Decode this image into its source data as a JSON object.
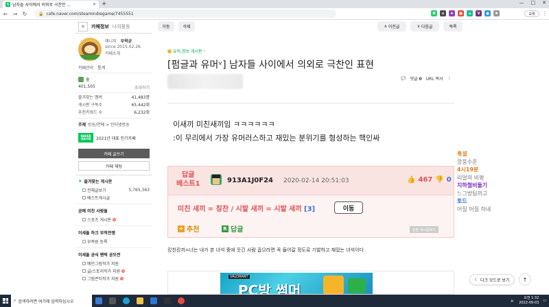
{
  "browser": {
    "tab_title": "남자들 사이에서 의외로 극찬인 ...",
    "url": "cafe.naver.com/steamindiegame/7455551",
    "profile_label": "오류"
  },
  "sidebar": {
    "tab_active": "카페정보",
    "tab_other": "나의활동",
    "manager_label": "매니저",
    "owner": "우왁굳",
    "since": "since 2015.02.26.",
    "intro_link": "카페소개",
    "link_manage": "카페관리",
    "link_stats": "통계",
    "grade": "숲",
    "members": "401,505",
    "invite": "초대하기",
    "stats": [
      {
        "label": "즐겨찾는 멤버",
        "value": "41,483명"
      },
      {
        "label": "게시판 구독수",
        "value": "65,442회"
      },
      {
        "label": "추천키워드 수",
        "value": "6,232회"
      }
    ],
    "topic_label": "주제",
    "topic_value": "방송/연예 > 인터넷방송",
    "badge_top": "NAVER",
    "badge_bottom": "대표카페",
    "badge_text": "2021년 대표 인기카페",
    "write_btn": "카페 글쓰기",
    "chat_btn": "카페 채팅",
    "fav_board_head": "즐겨찾는 게시판",
    "fav_items": [
      {
        "label": "전체글보기",
        "count": "5,765,363"
      },
      {
        "label": "베스트게시글",
        "count": ""
      }
    ],
    "cat1": "공예 미친 사람들",
    "cat1_items": [
      {
        "label": "스포츠 게시판",
        "new": "N"
      }
    ],
    "cat2": "이세돌 하크 부적전쟁",
    "cat2_items": [
      {
        "label": "부족원 등록",
        "new": ""
      }
    ],
    "cat3": "이세돌 공식 팬픽 공모전",
    "cat3_items": [
      {
        "label": "메인그림작가 지원",
        "new": ""
      },
      {
        "label": "글/스토리작가 지원",
        "new": "N"
      },
      {
        "label": "그림콘티작가 지원",
        "new": "N"
      }
    ]
  },
  "toolbar": {
    "move": "이동",
    "delete": "삭제",
    "prev": "이전글",
    "next": "다음글",
    "list": "목록"
  },
  "article": {
    "board": "유머,정보 게시판",
    "title": "[펌글과 유머ᵛ] 남자들 사이에서 의외로 극찬인 표현",
    "comment_label": "댓글",
    "comment_count": "0",
    "url_copy": "URL 복사",
    "body_line1": "이새끼 미친새끼임 ㅋㅋㅋㅋㅋㅋ",
    "body_line2": ":이 무리에서 가장 유머러스하고 재밌는 분위기를 형성하는 핵인싸",
    "caption": "킹친킹끼=너는 내가 본 녀석 중에 웃긴 사람 꼽으라면 꼭 들어갈 정도로 기발하고 재밌는 녀석이다"
  },
  "best_comment": {
    "label_top": "답글",
    "label_bottom": "베스트1",
    "nickname": "913A1J0F24",
    "date": "2020-02-14 20:51:03",
    "up": "467",
    "down": "0",
    "text_red": "미친 새끼 = 칭찬 / 시발 새끼 = 시발 새끼",
    "text_blue": "[3]",
    "move_btn": "이동",
    "recommend": "추천",
    "reply": "답글",
    "source_btn": "원본 게시글보기"
  },
  "ad": {
    "tag": "VALORANT",
    "text": "PC방 썸머"
  },
  "overlay": [
    {
      "text": "혹설",
      "color": "#e07a20",
      "kind": "name"
    },
    {
      "text": "깡풍수준",
      "color": "#777777",
      "kind": "msg"
    },
    {
      "text": "4시19분",
      "color": "#e07a20",
      "kind": "name"
    },
    {
      "text": "리얼의 비평",
      "color": "#777777",
      "kind": "msg"
    },
    {
      "text": "지하철비둘기",
      "color": "#7a2fbf",
      "kind": "name"
    },
    {
      "text": "느그방팀까고",
      "color": "#777777",
      "kind": "msg"
    },
    {
      "text": "토드",
      "color": "#2a6fd0",
      "kind": "name"
    },
    {
      "text": "어질 어질 하네",
      "color": "#777777",
      "kind": "msg"
    }
  ],
  "floating": {
    "dark_mode": "다크 모드로 보기"
  },
  "taskbar": {
    "search": "검색하려면 여기에 입력하십시오",
    "time": "오전 1:32",
    "date": "2022-09-03"
  }
}
